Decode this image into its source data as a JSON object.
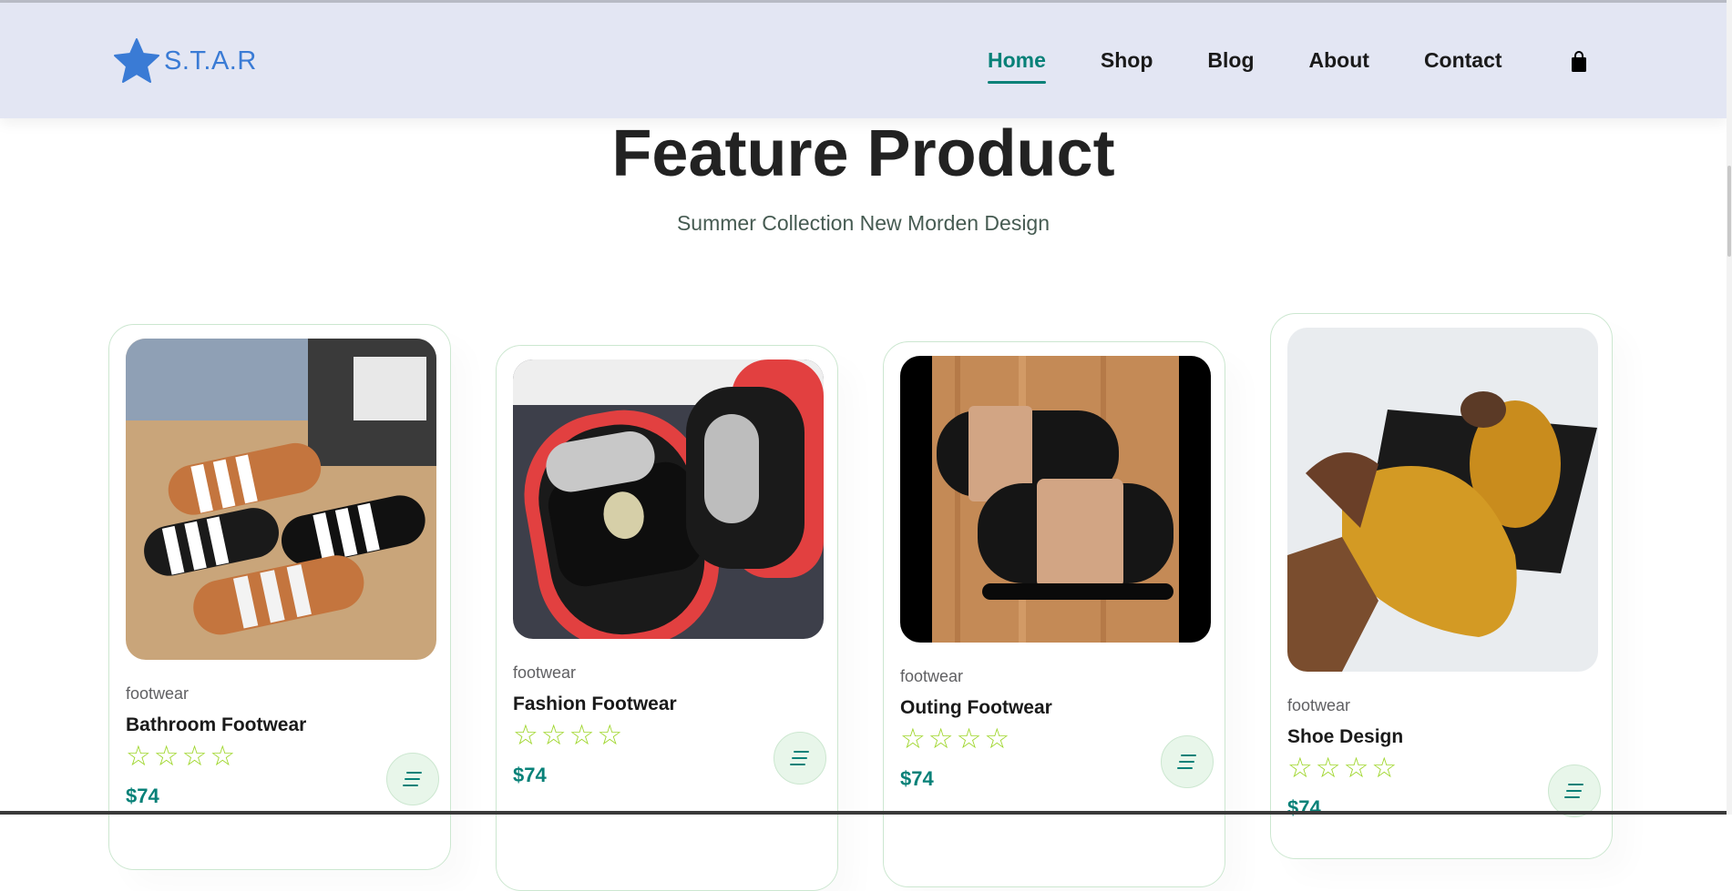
{
  "brand": {
    "logo_text": "S.T.A.R",
    "logo_icon": "star-icon",
    "logo_color": "#3a7bd5"
  },
  "nav": {
    "items": [
      {
        "label": "Home",
        "active": true
      },
      {
        "label": "Shop",
        "active": false
      },
      {
        "label": "Blog",
        "active": false
      },
      {
        "label": "About",
        "active": false
      },
      {
        "label": "Contact",
        "active": false
      }
    ],
    "cart_icon": "shopping-bag-icon"
  },
  "section": {
    "title": "Feature Product",
    "subtitle": "Summer Collection New Morden Design"
  },
  "products": [
    {
      "brand": "footwear",
      "name": "Bathroom Footwear",
      "stars": "☆☆☆☆",
      "rating": 4,
      "price": "$74"
    },
    {
      "brand": "footwear",
      "name": "Fashion Footwear",
      "stars": "☆☆☆☆",
      "rating": 4,
      "price": "$74"
    },
    {
      "brand": "footwear",
      "name": "Outing Footwear",
      "stars": "☆☆☆☆",
      "rating": 4,
      "price": "$74"
    },
    {
      "brand": "footwear",
      "name": "Shoe Design",
      "stars": "☆☆☆☆",
      "rating": 4,
      "price": "$74"
    }
  ],
  "colors": {
    "accent": "#088178",
    "header_bg": "#e3e6f3",
    "star": "#9fd62c",
    "cart_button_bg": "#e8f6ea"
  }
}
